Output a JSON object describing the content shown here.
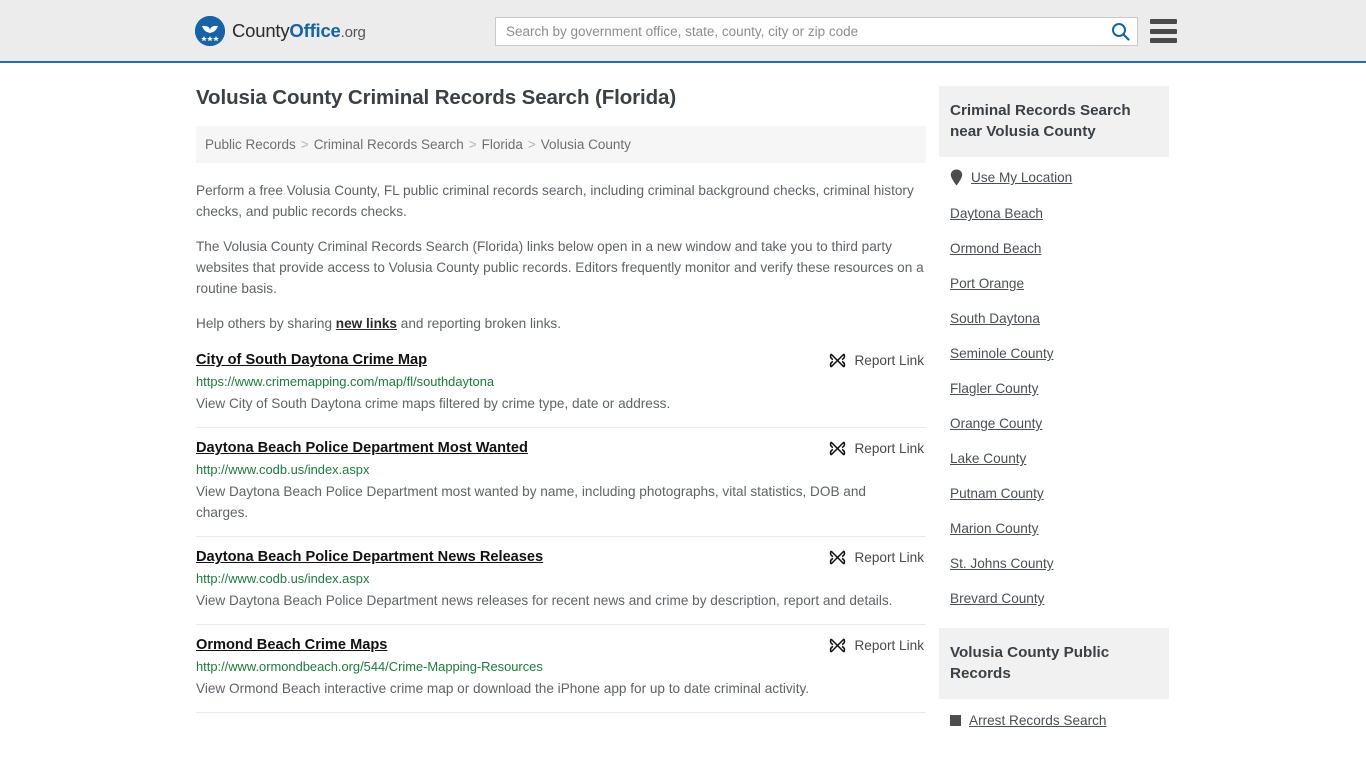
{
  "header": {
    "brand": {
      "part1": "County",
      "part2": "Office",
      "part3": ".org",
      "logo_icon": "eagle-stars-logo"
    },
    "search": {
      "placeholder": "Search by government office, state, county, city or zip code",
      "value": "",
      "icon": "search-icon"
    },
    "menu": {
      "icon": "hamburger-menu-icon",
      "label": "Menu"
    }
  },
  "main": {
    "title": "Volusia County Criminal Records Search (Florida)",
    "breadcrumb": [
      {
        "label": "Public Records"
      },
      {
        "label": "Criminal Records Search"
      },
      {
        "label": "Florida"
      },
      {
        "label": "Volusia County"
      }
    ],
    "breadcrumb_separator": ">",
    "intro": [
      "Perform a free Volusia County, FL public criminal records search, including criminal background checks, criminal history checks, and public records checks.",
      "The Volusia County Criminal Records Search (Florida) links below open in a new window and take you to third party websites that provide access to Volusia County public records. Editors frequently monitor and verify these resources on a routine basis."
    ],
    "help_prefix": "Help others by sharing ",
    "help_link": "new links",
    "help_suffix": " and reporting broken links.",
    "report_label": "Report Link",
    "report_icon": "broken-link-icon",
    "results": [
      {
        "title": "City of South Daytona Crime Map",
        "url": "https://www.crimemapping.com/map/fl/southdaytona",
        "description": "View City of South Daytona crime maps filtered by crime type, date or address."
      },
      {
        "title": "Daytona Beach Police Department Most Wanted",
        "url": "http://www.codb.us/index.aspx",
        "description": "View Daytona Beach Police Department most wanted by name, including photographs, vital statistics, DOB and charges."
      },
      {
        "title": "Daytona Beach Police Department News Releases",
        "url": "http://www.codb.us/index.aspx",
        "description": "View Daytona Beach Police Department news releases for recent news and crime by description, report and details."
      },
      {
        "title": "Ormond Beach Crime Maps",
        "url": "http://www.ormondbeach.org/544/Crime-Mapping-Resources",
        "description": "View Ormond Beach interactive crime map or download the iPhone app for up to date criminal activity."
      }
    ]
  },
  "sidebar": {
    "nearby": {
      "heading": "Criminal Records Search near Volusia County",
      "use_my_location": {
        "label": "Use My Location",
        "icon": "map-pin-icon"
      },
      "links": [
        {
          "label": "Daytona Beach"
        },
        {
          "label": "Ormond Beach"
        },
        {
          "label": "Port Orange"
        },
        {
          "label": "South Daytona"
        },
        {
          "label": "Seminole County"
        },
        {
          "label": "Flagler County"
        },
        {
          "label": "Orange County"
        },
        {
          "label": "Lake County"
        },
        {
          "label": "Putnam County"
        },
        {
          "label": "Marion County"
        },
        {
          "label": "St. Johns County"
        },
        {
          "label": "Brevard County"
        }
      ]
    },
    "public_records": {
      "heading": "Volusia County Public Records",
      "links": [
        {
          "label": "Arrest Records Search",
          "icon": "square-bullet-icon"
        }
      ]
    }
  },
  "colors": {
    "brand_blue": "#1763a6",
    "header_bg": "#ececec",
    "header_border": "#2b6ca3",
    "url_green": "#1f7a3d",
    "panel_bg": "#f1f1f1"
  }
}
